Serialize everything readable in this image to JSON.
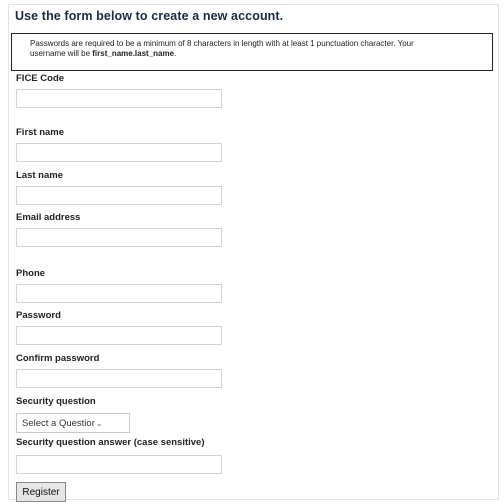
{
  "form": {
    "heading": "Use the form below to create a new account.",
    "notice": {
      "line1": "Passwords are required to be a minimum of 8 characters in length with at least 1 punctuation character. Your",
      "line2_prefix": "username will be ",
      "line2_bold": "first_name.last_name",
      "line2_suffix": "."
    },
    "fields": {
      "fice_code": {
        "label": "FICE Code",
        "value": ""
      },
      "first_name": {
        "label": "First name",
        "value": ""
      },
      "last_name": {
        "label": "Last name",
        "value": ""
      },
      "email": {
        "label": "Email address",
        "value": ""
      },
      "phone": {
        "label": "Phone",
        "value": ""
      },
      "password": {
        "label": "Password",
        "value": ""
      },
      "confirm_password": {
        "label": "Confirm password",
        "value": ""
      },
      "security_question": {
        "label": "Security question",
        "selected": "Select a Questior"
      },
      "security_answer": {
        "label": "Security question answer (case sensitive)",
        "value": ""
      }
    },
    "register_label": "Register"
  }
}
